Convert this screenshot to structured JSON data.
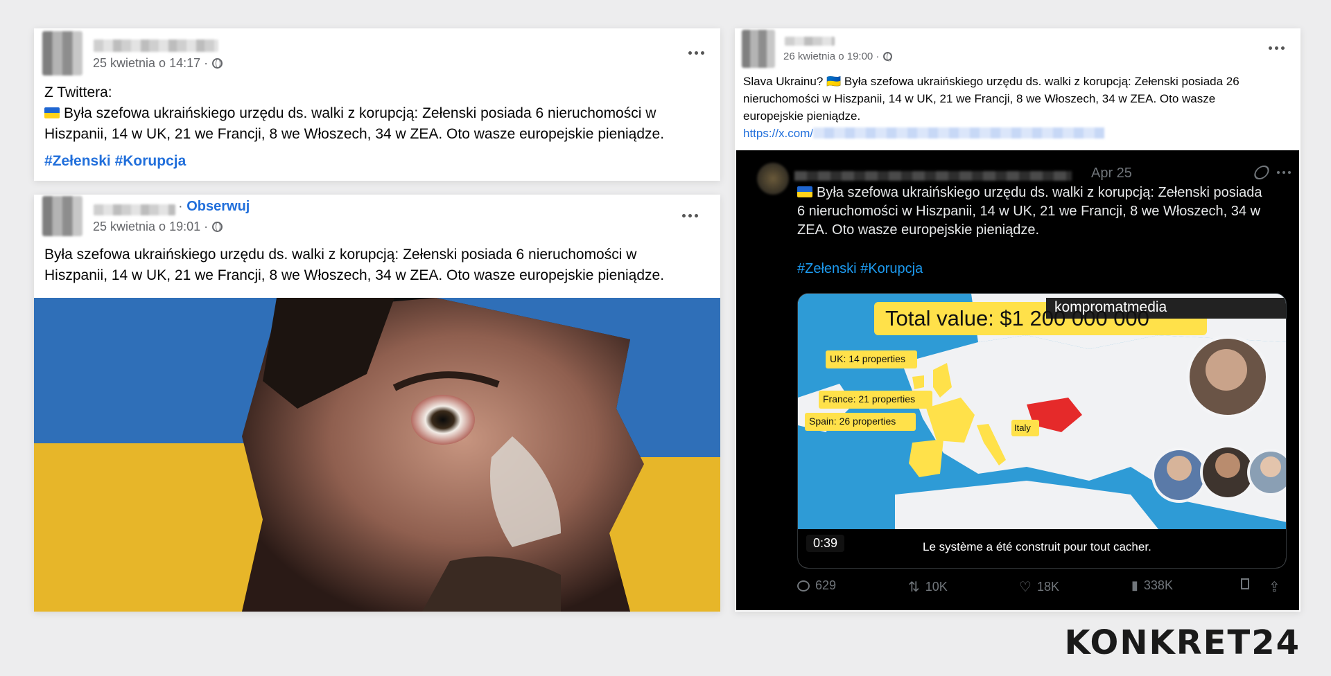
{
  "post1": {
    "date": "25 kwietnia o 14:17 ·",
    "line0": "Z Twittera:",
    "line1": "Była szefowa ukraińskiego urzędu ds. walki z korupcją: Zełenski posiada 6 nieruchomości w",
    "line2": "Hiszpanii, 14 w UK, 21 we Francji, 8 we Włoszech, 34 w ZEA. Oto wasze europejskie pieniądze.",
    "tag1": "#Zełenski",
    "tag2": "#Korupcja"
  },
  "post2": {
    "follow": "Obserwuj",
    "sep": "·",
    "date": "25 kwietnia o 19:01 ·",
    "line1": "Była szefowa ukraińskiego urzędu ds. walki z korupcją: Zełenski posiada 6 nieruchomości w",
    "line2": "Hiszpanii, 14 w UK, 21 we Francji, 8 we Włoszech, 34 w ZEA. Oto wasze europejskie pieniądze."
  },
  "post3": {
    "date": "26 kwietnia o 19:00 ·",
    "line1": "Slava Ukrainu? 🇺🇦 Była szefowa ukraińskiego urzędu ds. walki z korupcją: Zełenski posiada 26",
    "line2": "nieruchomości w Hiszpanii, 14 w UK, 21 we Francji, 8 we Włoszech, 34 w ZEA. Oto wasze",
    "line3": "europejskie pieniądze.",
    "link": "https://x.com/"
  },
  "tweet": {
    "date": "Apr 25",
    "line1": "Była szefowa ukraińskiego urzędu ds. walki z korupcją: Zełenski posiada",
    "line2": "6 nieruchomości w Hiszpanii, 14 w UK, 21 we Francji, 8 we Włoszech, 34 w",
    "line3": "ZEA. Oto wasze europejskie pieniądze.",
    "tags": "#Zełenski #Korupcja",
    "video": {
      "watermark": "kompromatmedia",
      "headline": "Total value: $1 200 000 000",
      "labels": {
        "uk": "UK: 14 properties",
        "france": "France: 21 properties",
        "spain": "Spain: 26 properties",
        "italy": "Italy"
      },
      "time": "0:39",
      "subtitle": "Le système a été construit pour tout cacher."
    },
    "stats": {
      "replies": "629",
      "reposts": "10K",
      "likes": "18K",
      "views": "338K"
    }
  },
  "brand": "KONKRET24",
  "colors": {
    "fb_link": "#216fdb",
    "x_link": "#1d9bf0",
    "ua_blue": "#1f66d1",
    "ua_yellow": "#ffd21a"
  }
}
